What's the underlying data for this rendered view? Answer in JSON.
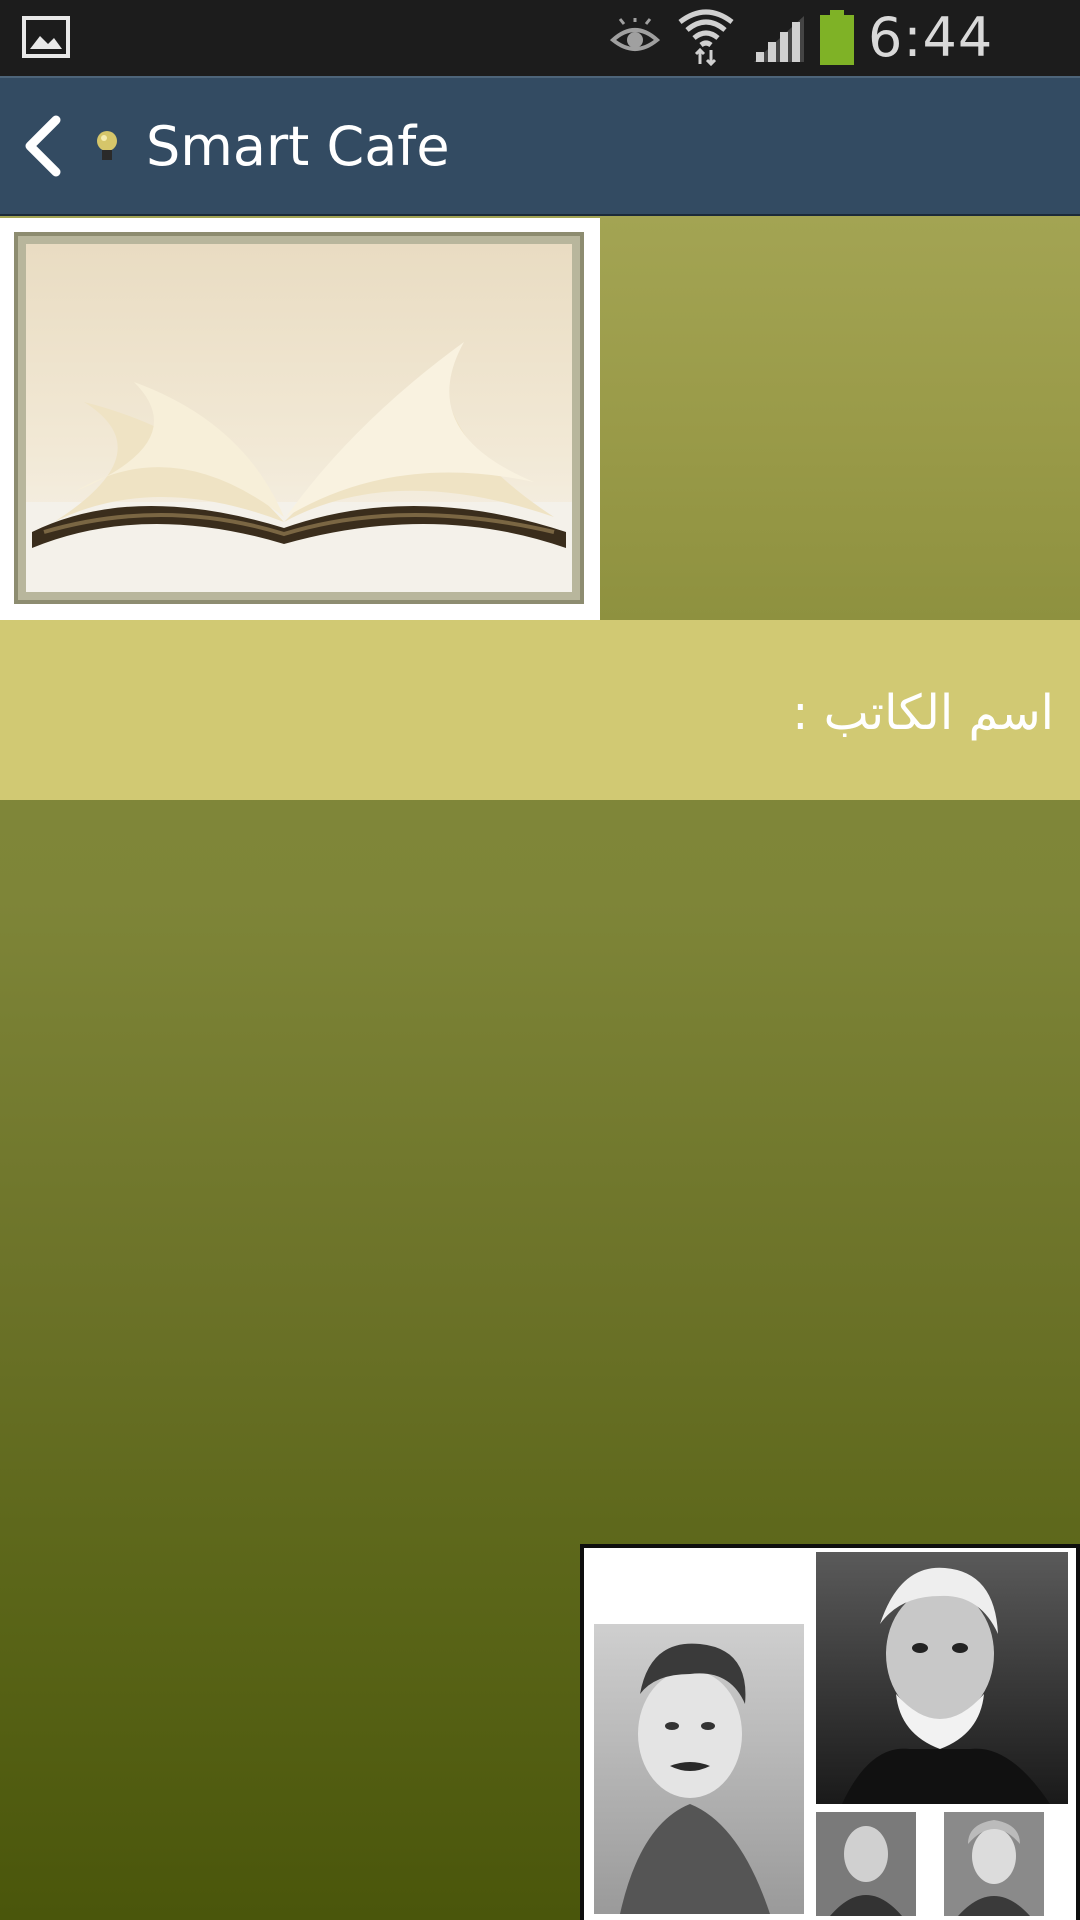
{
  "status_bar": {
    "time": "6:44 PM",
    "icons": [
      "gallery-icon",
      "eye-icon",
      "wifi-icon",
      "signal-icon",
      "battery-icon"
    ],
    "battery_color": "#7fb226"
  },
  "action_bar": {
    "title": "Smart Cafe",
    "background": "#334b62"
  },
  "content": {
    "author_label": "اسم الكاتب :",
    "author_row_color": "#d1c973",
    "images": [
      "open-book-image",
      "writers-collage-image"
    ]
  }
}
